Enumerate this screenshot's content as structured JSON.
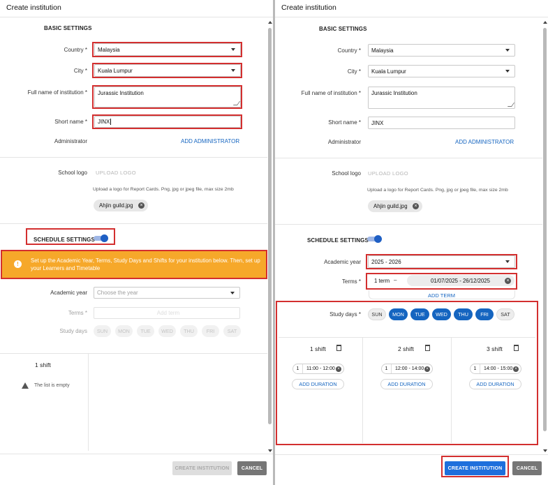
{
  "dialog_title": "Create institution",
  "basic": {
    "heading": "BASIC SETTINGS",
    "country_label": "Country *",
    "country_value": "Malaysia",
    "city_label": "City *",
    "city_value": "Kuala Lumpur",
    "fullname_label": "Full name of institution *",
    "fullname_value": "Jurassic Institution",
    "shortname_label": "Short name *",
    "shortname_value": "JINX",
    "admin_label": "Administrator",
    "add_admin": "ADD ADMINISTRATOR"
  },
  "logo": {
    "label": "School logo",
    "upload": "UPLOAD LOGO",
    "hint": "Upload a logo for Report Cards. Png, jpg or jpeg file, max size 2mb",
    "file": "Ahjin guild.jpg"
  },
  "schedule": {
    "heading": "SCHEDULE SETTINGS",
    "toggle_on": true,
    "banner": "Set up the Academic Year, Terms, Study Days and Shifts for your institution below. Then, set up your Learners and Timetable",
    "academic_year_label": "Academic year",
    "academic_year_placeholder": "Choose the year",
    "academic_year_value": "2025 - 2026",
    "terms_label": "Terms *",
    "terms_placeholder": "Add term",
    "term_name": "1 term",
    "term_dash": "–",
    "term_range": "01/07/2025 - 26/12/2025",
    "add_term": "ADD TERM",
    "study_days_label": "Study days",
    "study_days_label_req": "Study days *",
    "days": [
      "SUN",
      "MON",
      "TUE",
      "WED",
      "THU",
      "FRI",
      "SAT"
    ],
    "days_selected": [
      false,
      true,
      true,
      true,
      true,
      true,
      false
    ]
  },
  "shifts_empty": {
    "title": "1 shift",
    "empty": "The list is empty"
  },
  "shifts": [
    {
      "title": "1 shift",
      "num": "1",
      "time": "11:00 - 12:00",
      "add": "ADD DURATION"
    },
    {
      "title": "2 shift",
      "num": "1",
      "time": "12:00 - 14:00",
      "add": "ADD DURATION"
    },
    {
      "title": "3 shift",
      "num": "1",
      "time": "14:00 - 15:00",
      "add": "ADD DURATION"
    }
  ],
  "footer": {
    "create": "CREATE INSTITUTION",
    "cancel": "CANCEL"
  },
  "colors": {
    "accent": "#1565c0",
    "banner": "#f6a82a",
    "highlight": "#d32f2f"
  }
}
